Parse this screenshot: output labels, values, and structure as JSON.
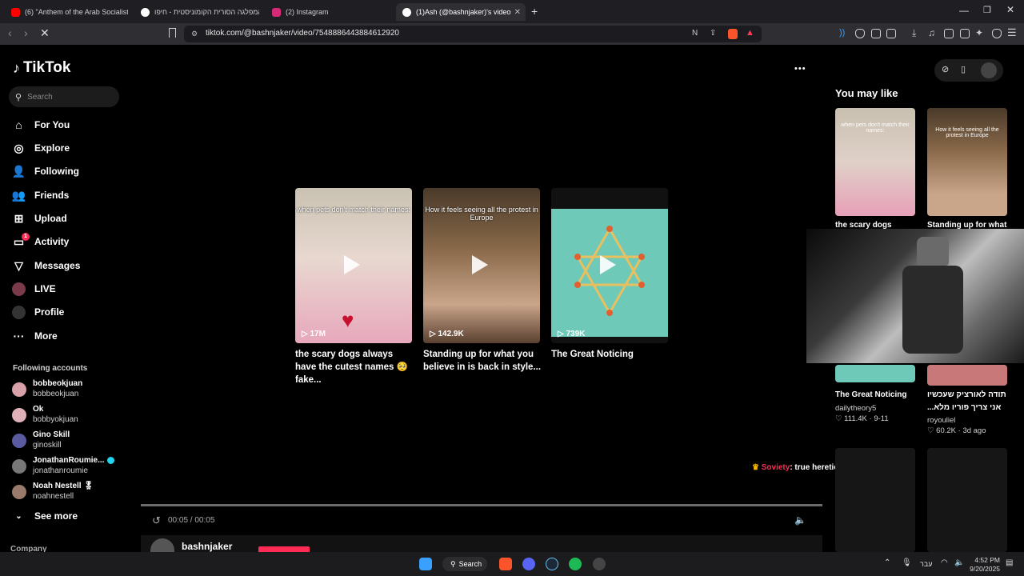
{
  "browser": {
    "tabs": [
      {
        "title": "(6) \"Anthem of the Arab Socialist Ba'",
        "color": "#ff0000"
      },
      {
        "title": "המפלגה הסורית הקומוניסטית - חיפו",
        "color": "#ffffff"
      },
      {
        "title": "(2) Instagram",
        "color": "#d62976"
      },
      {
        "title": "(1)Ash (@bashnjaker)'s videos wi",
        "color": "#ffffff"
      }
    ],
    "new_tab": "+",
    "url": "tiktok.com/@bashnjaker/video/7548886443884612920"
  },
  "sidebar": {
    "logo": "TikTok",
    "search_placeholder": "Search",
    "nav": [
      {
        "label": "For You",
        "icon": "home-icon"
      },
      {
        "label": "Explore",
        "icon": "compass-icon"
      },
      {
        "label": "Following",
        "icon": "following-icon"
      },
      {
        "label": "Friends",
        "icon": "friends-icon"
      },
      {
        "label": "Upload",
        "icon": "upload-icon"
      },
      {
        "label": "Activity",
        "icon": "activity-icon",
        "badge": "1"
      },
      {
        "label": "Messages",
        "icon": "messages-icon"
      },
      {
        "label": "LIVE",
        "icon": "live-icon"
      },
      {
        "label": "Profile",
        "icon": "profile-icon"
      },
      {
        "label": "More",
        "icon": "more-icon"
      }
    ],
    "following_header": "Following accounts",
    "accounts": [
      {
        "name": "bobbeokjuan",
        "handle": "bobbeokjuan"
      },
      {
        "name": "Ok",
        "handle": "bobbyokjuan"
      },
      {
        "name": "Gino Skill",
        "handle": "ginoskill"
      },
      {
        "name": "JonathanRoumie...",
        "handle": "jonathanroumie"
      },
      {
        "name": "Noah Nestell 🎖",
        "handle": "noahnestell"
      }
    ],
    "see_more": "See more",
    "company": "Company"
  },
  "main": {
    "more_dots": "•••",
    "videos": [
      {
        "caption": "when pets don't match their names:",
        "views": "17M",
        "title": "the scary dogs always have the cutest names 🥺 fake..."
      },
      {
        "caption": "How it feels seeing all the protest in Europe",
        "views": "142.9K",
        "title": "Standing up for what you believe in is back in style..."
      },
      {
        "caption": "",
        "views": "739K",
        "title": "The Great Noticing"
      }
    ],
    "comment_user": "Soviety",
    "comment_text": ": true heretic",
    "time": "00:05 / 00:05",
    "author": "bashnjaker"
  },
  "right": {
    "heading": "You may like",
    "items": [
      {
        "title": "the scary dogs",
        "caption": "when pets don't match their names:"
      },
      {
        "title": "Standing up for what",
        "caption": "How it feels seeing all the protest in Europe"
      },
      {
        "title": "The Great Noticing",
        "author": "dailytheory5",
        "likes": "111.4K",
        "date": "9-11"
      },
      {
        "title": "תודה לאורציק שעכשיו אני צריך פוריו מלא...",
        "author": "royouliel",
        "likes": "60.2K",
        "date": "3d ago"
      }
    ]
  },
  "taskbar": {
    "search": "Search",
    "lang": "עבר",
    "time": "4:52 PM",
    "date": "9/20/2025"
  }
}
